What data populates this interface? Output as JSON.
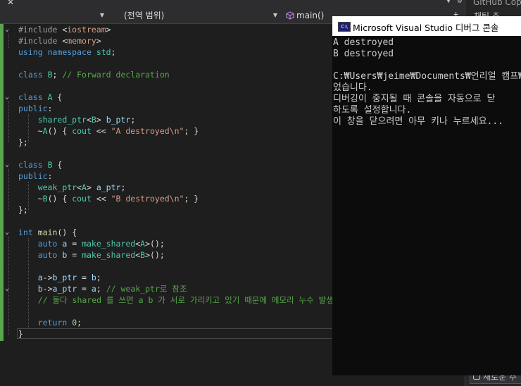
{
  "tabstrip": {
    "close_glyph": "✕"
  },
  "navbar": {
    "project_value": "",
    "scope_value": "(전역 범위)",
    "member_value": "main()"
  },
  "side_panel": {
    "title": "GitHub Copilot",
    "top_text": "채팅 추",
    "input_text": "새로운 추"
  },
  "code_lines": [
    "#include <iostream>",
    "#include <memory>",
    "using namespace std;",
    "",
    "class B; // Forward declaration",
    "",
    "class A {",
    "public:",
    "    shared_ptr<B> b_ptr;",
    "    ~A() { cout << \"A destroyed\\n\"; }",
    "};",
    "",
    "class B {",
    "public:",
    "    weak_ptr<A> a_ptr;",
    "    ~B() { cout << \"B destroyed\\n\"; }",
    "};",
    "",
    "int main() {",
    "    auto a = make_shared<A>();",
    "    auto b = make_shared<B>();",
    "",
    "    a->b_ptr = b;",
    "    b->a_ptr = a; // weak_ptr로 참조",
    "    // 둘다 shared 를 쓰면 a b 가 서로 가리키고 있기 때문에 메모리 누수 발생",
    "",
    "    return 0;",
    "}"
  ],
  "console": {
    "title": "Microsoft Visual Studio 디버그 콘솔",
    "lines": [
      "A destroyed",
      "B destroyed",
      "",
      "C:₩Users₩jeime₩Documents₩언리얼 캠프₩",
      "었습니다.",
      "디버깅이 중지될 때 콘솔을 자동으로 닫",
      "하도록 설정합니다.",
      "이 창을 닫으려면 아무 키나 누르세요..."
    ]
  },
  "icons": {
    "member_icon": "cube-icon",
    "console_icon": "console-app-icon"
  },
  "colors": {
    "keyword": "#569cd6",
    "type": "#4ec9b0",
    "string": "#d69d85",
    "comment": "#57a64a",
    "change_bar": "#57a64a"
  }
}
